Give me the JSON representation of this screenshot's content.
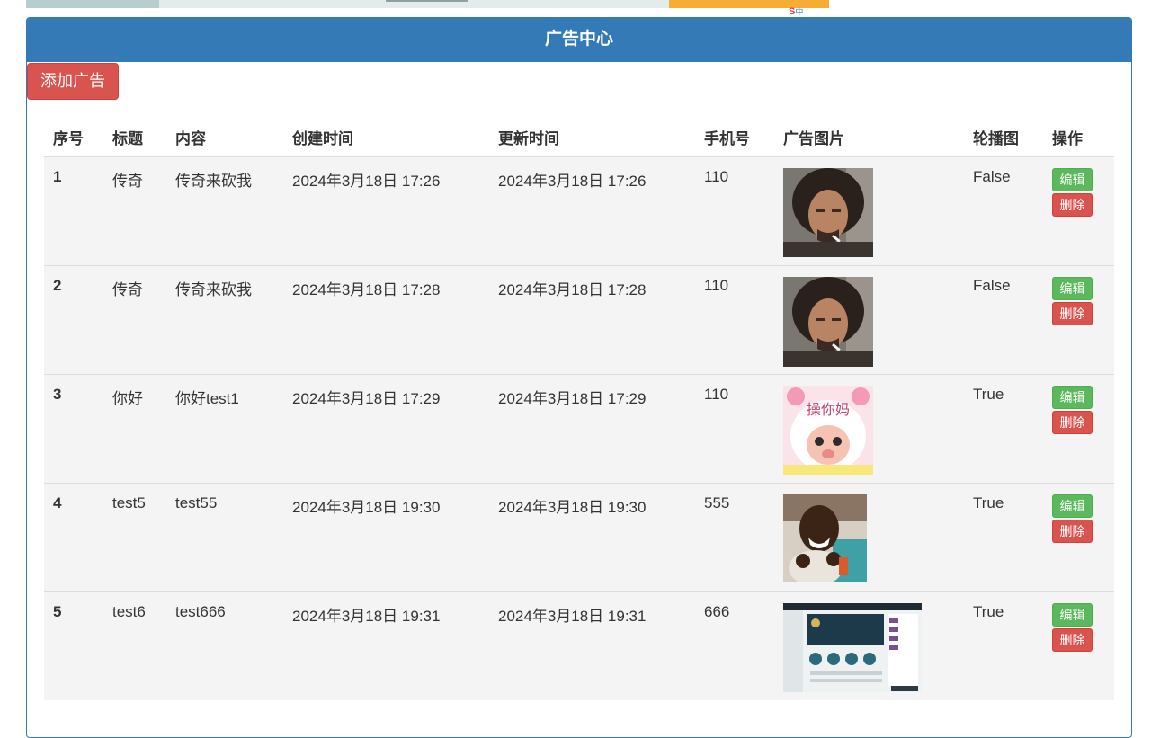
{
  "browser_strip": {
    "brand_label": "S",
    "lang_label": "中"
  },
  "panel": {
    "title": "广告中心",
    "add_button": "添加广告"
  },
  "table": {
    "headers": [
      "序号",
      "标题",
      "内容",
      "创建时间",
      "更新时间",
      "手机号",
      "广告图片",
      "轮播图",
      "操作"
    ],
    "rows": [
      {
        "id": "1",
        "title": "传奇",
        "content": "传奇来砍我",
        "created": "2024年3月18日 17:26",
        "updated": "2024年3月18日 17:26",
        "phone": "110",
        "image": "portrait-man-smoking",
        "carousel": "False",
        "edit": "编辑",
        "delete": "删除"
      },
      {
        "id": "2",
        "title": "传奇",
        "content": "传奇来砍我",
        "created": "2024年3月18日 17:28",
        "updated": "2024年3月18日 17:28",
        "phone": "110",
        "image": "portrait-man-smoking",
        "carousel": "False",
        "edit": "编辑",
        "delete": "删除"
      },
      {
        "id": "3",
        "title": "你好",
        "content": "你好test1",
        "created": "2024年3月18日 17:29",
        "updated": "2024年3月18日 17:29",
        "phone": "110",
        "image": "cartoon-sheep-sticker",
        "image_text": "操你妈",
        "carousel": "True",
        "edit": "编辑",
        "delete": "删除"
      },
      {
        "id": "4",
        "title": "test5",
        "content": "test55",
        "created": "2024年3月18日 19:30",
        "updated": "2024年3月18日 19:30",
        "phone": "555",
        "image": "laughing-man-photo",
        "carousel": "True",
        "edit": "编辑",
        "delete": "删除"
      },
      {
        "id": "5",
        "title": "test6",
        "content": "test666",
        "created": "2024年3月18日 19:31",
        "updated": "2024年3月18日 19:31",
        "phone": "666",
        "image": "game-dashboard-screenshot",
        "carousel": "True",
        "edit": "编辑",
        "delete": "删除"
      }
    ]
  },
  "colors": {
    "primary": "#337ab7",
    "danger": "#d9534f",
    "success": "#5cb85c",
    "row_bg": "#f4f4f4"
  }
}
